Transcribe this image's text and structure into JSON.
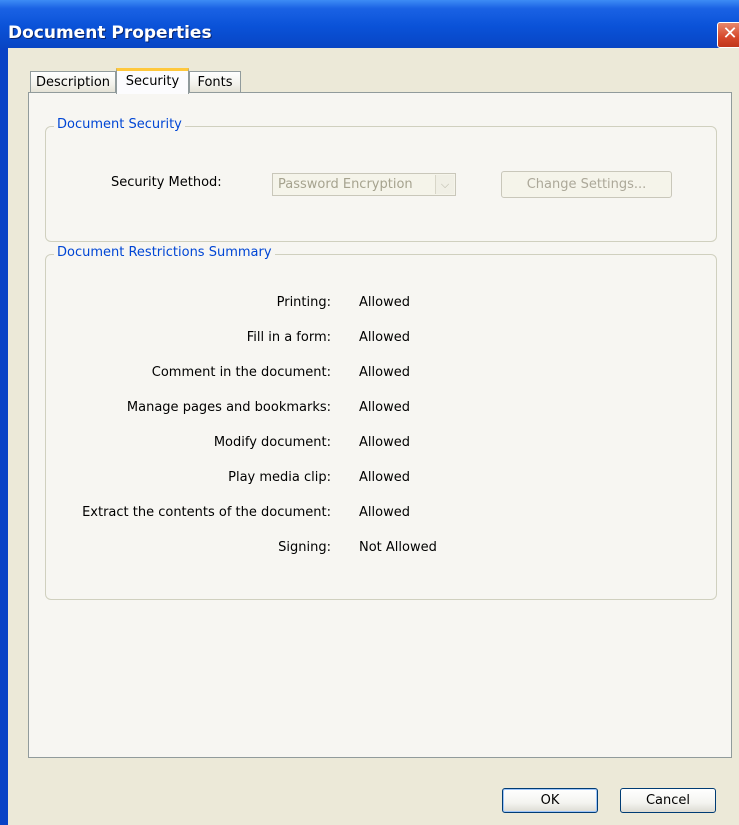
{
  "window": {
    "title": "Document Properties",
    "close_glyph": "✕"
  },
  "tabs": [
    {
      "label": "Description",
      "active": false
    },
    {
      "label": "Security",
      "active": true
    },
    {
      "label": "Fonts",
      "active": false
    }
  ],
  "security_group": {
    "legend": "Document Security",
    "method_label": "Security Method:",
    "method_value": "Password Encryption",
    "change_settings_label": "Change Settings..."
  },
  "restrictions_group": {
    "legend": "Document Restrictions Summary",
    "rows": [
      {
        "label": "Printing:",
        "value": "Allowed"
      },
      {
        "label": "Fill in a form:",
        "value": "Allowed"
      },
      {
        "label": "Comment in the document:",
        "value": "Allowed"
      },
      {
        "label": "Manage pages and bookmarks:",
        "value": "Allowed"
      },
      {
        "label": "Modify document:",
        "value": "Allowed"
      },
      {
        "label": "Play media clip:",
        "value": "Allowed"
      },
      {
        "label": "Extract the contents of the document:",
        "value": "Allowed"
      },
      {
        "label": "Signing:",
        "value": "Not Allowed"
      }
    ]
  },
  "footer": {
    "ok_label": "OK",
    "cancel_label": "Cancel"
  },
  "icons": {
    "close": "close-icon",
    "dropdown": "chevron-down-icon"
  },
  "colors": {
    "titlebar": "#0a52d8",
    "legend_text": "#0046d5",
    "dialog_bg": "#ece9d8",
    "active_tab_accent": "#ffc83c"
  }
}
